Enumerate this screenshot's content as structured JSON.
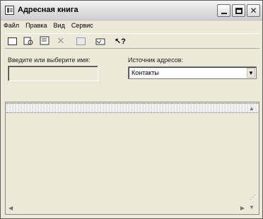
{
  "window": {
    "title": "Адресная книга"
  },
  "menu": {
    "file": "Файл",
    "edit": "Правка",
    "view": "Вид",
    "service": "Сервис"
  },
  "toolbar": {
    "icons": [
      "new-contact-icon",
      "find-icon",
      "properties-icon",
      "delete-icon",
      "print-icon",
      "new-folder-icon",
      "help-icon"
    ]
  },
  "form": {
    "name_label": "Введите или выберите имя:",
    "name_value": "",
    "source_label": "Источник адресов:",
    "source_selected": "Контакты"
  }
}
